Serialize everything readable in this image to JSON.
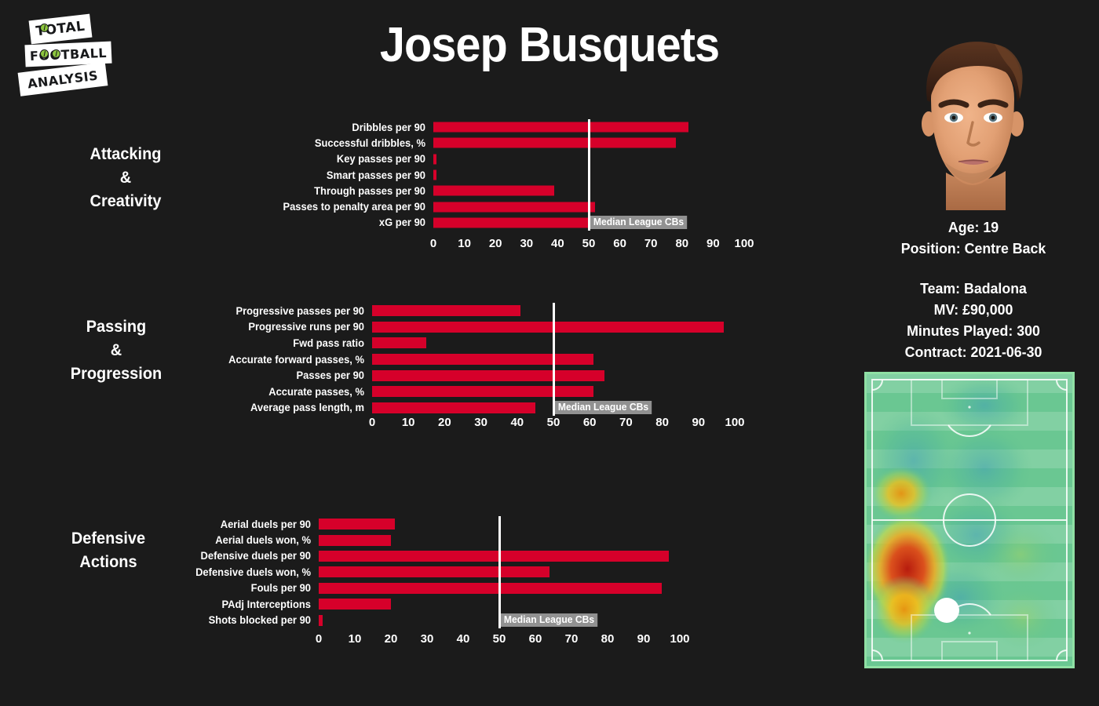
{
  "brand": {
    "logo_line1": "TOTAL",
    "logo_line2": "FOOTBALL",
    "logo_line3": "ANALYSIS"
  },
  "header": {
    "player_name": "Josep Busquets"
  },
  "player_info": {
    "age": "Age: 19",
    "position": "Position: Centre Back",
    "team": "Team: Badalona",
    "market_value": "MV: £90,000",
    "minutes": "Minutes Played: 300",
    "contract": "Contract: 2021-06-30"
  },
  "median_label": "Median League CBs",
  "colors": {
    "background": "#1b1b1b",
    "bar": "#d6002a",
    "median_line": "#ffffff",
    "text": "#ffffff",
    "pitch_border": "#8fe0a4"
  },
  "chart_data": [
    {
      "type": "bar",
      "title": "Attacking\n&\nCreativity",
      "category_lines": [
        "Attacking",
        "&",
        "Creativity"
      ],
      "orientation": "horizontal",
      "categories": [
        "Dribbles per 90",
        "Successful dribbles, %",
        "Key passes per 90",
        "Smart passes per 90",
        "Through passes per 90",
        "Passes to penalty area per 90",
        "xG per 90"
      ],
      "values": [
        82,
        78,
        1,
        1,
        39,
        52,
        50
      ],
      "xlabel": "",
      "ylabel": "",
      "xlim": [
        0,
        100
      ],
      "ticks": [
        0,
        10,
        20,
        30,
        40,
        50,
        60,
        70,
        80,
        90,
        100
      ],
      "median": 50,
      "grid": false
    },
    {
      "type": "bar",
      "title": "Passing\n&\nProgression",
      "category_lines": [
        "Passing",
        "&",
        "Progression"
      ],
      "orientation": "horizontal",
      "categories": [
        "Progressive passes per 90",
        "Progressive runs per 90",
        "Fwd pass ratio",
        "Accurate forward passes, %",
        "Passes per 90",
        "Accurate passes, %",
        "Average pass length, m"
      ],
      "values": [
        41,
        97,
        15,
        61,
        64,
        61,
        45
      ],
      "xlabel": "",
      "ylabel": "",
      "xlim": [
        0,
        100
      ],
      "ticks": [
        0,
        10,
        20,
        30,
        40,
        50,
        60,
        70,
        80,
        90,
        100
      ],
      "median": 50,
      "grid": false
    },
    {
      "type": "bar",
      "title": "Defensive\nActions",
      "category_lines": [
        "Defensive",
        "Actions"
      ],
      "orientation": "horizontal",
      "categories": [
        "Aerial duels per 90",
        "Aerial duels won, %",
        "Defensive duels per 90",
        "Defensive duels won, %",
        "Fouls per 90",
        "PAdj Interceptions",
        "Shots blocked per 90"
      ],
      "values": [
        21,
        20,
        97,
        64,
        95,
        20,
        1
      ],
      "xlabel": "",
      "ylabel": "",
      "xlim": [
        0,
        100
      ],
      "ticks": [
        0,
        10,
        20,
        30,
        40,
        50,
        60,
        70,
        80,
        90,
        100
      ],
      "median": 50,
      "grid": false
    }
  ]
}
